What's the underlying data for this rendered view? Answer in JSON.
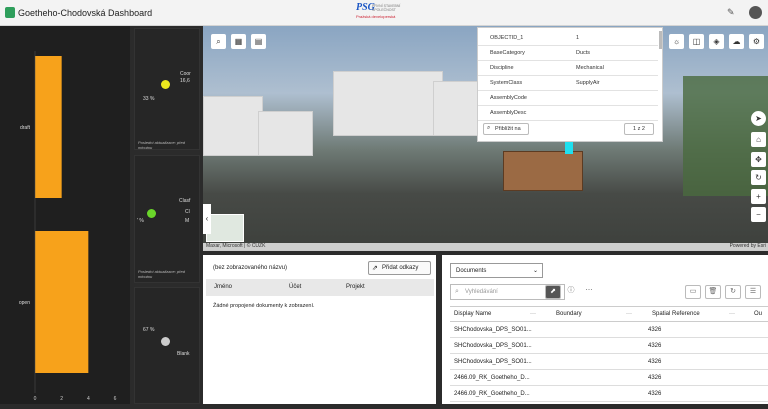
{
  "header": {
    "title": "Goetheho-Chodovská Dashboard",
    "brand_logo": "PSG",
    "brand_sub": "PRVNÍ STAVEBNÍ SPOLEČNOST",
    "brand_red": "Pražská developerská"
  },
  "bar_chart": {
    "chart_data": {
      "type": "bar",
      "orientation": "horizontal",
      "categories": [
        "draft",
        "open"
      ],
      "values": [
        2,
        4
      ],
      "xlim": [
        0,
        6
      ]
    },
    "x_ticks": [
      "0",
      "2",
      "4",
      "6"
    ]
  },
  "indicators": [
    {
      "percent": "33 %",
      "label": "Coor",
      "value": "16,6",
      "color": "#ede81e",
      "update": "Poslední aktualizace: před minutou"
    },
    {
      "percent": "' %",
      "label": "Clasf",
      "value": "Cl",
      "extra": "M",
      "color": "#6ad62a",
      "update": "Poslední aktualizace: před minutou"
    },
    {
      "percent": "67 %",
      "label": "Blank",
      "value": "",
      "color": "#cccccc",
      "update": "Poslední aktualizace: před minutou"
    }
  ],
  "scene": {
    "attribution": "Maxar, Microsoft | © ČÚZK",
    "powered": "Powered by Esri"
  },
  "popup": {
    "rows": [
      {
        "key": "OBJECTID_1",
        "value": "1"
      },
      {
        "key": "BaseCategory",
        "value": "Ducts"
      },
      {
        "key": "Discipline",
        "value": "Mechanical"
      },
      {
        "key": "SystemClass",
        "value": "SupplyAir"
      },
      {
        "key": "AssemblyCode",
        "value": ""
      },
      {
        "key": "AssemblyDesc",
        "value": ""
      }
    ],
    "zoom_label": "Přiblížit na",
    "pager": "1 z 2"
  },
  "related": {
    "title": "(bez zobrazovaného názvu)",
    "add_link": "Přidat odkazy",
    "columns": [
      "Jméno",
      "Účet",
      "Projekt"
    ],
    "empty": "Žádné propojené dokumenty k zobrazení."
  },
  "documents": {
    "select": "Documents",
    "search_placeholder": "Vyhledávání",
    "columns": [
      "Display Name",
      "Boundary",
      "Spatial Reference",
      "Ou"
    ],
    "rows": [
      {
        "name": "SHChodovska_DPS_SO01...",
        "sr": "4326"
      },
      {
        "name": "SHChodovska_DPS_SO01...",
        "sr": "4326"
      },
      {
        "name": "SHChodovska_DPS_SO01...",
        "sr": "4326"
      },
      {
        "name": "2466.09_RK_Goetheho_D...",
        "sr": "4326"
      },
      {
        "name": "2466.09_RK_Goetheho_D...",
        "sr": "4326"
      }
    ]
  }
}
